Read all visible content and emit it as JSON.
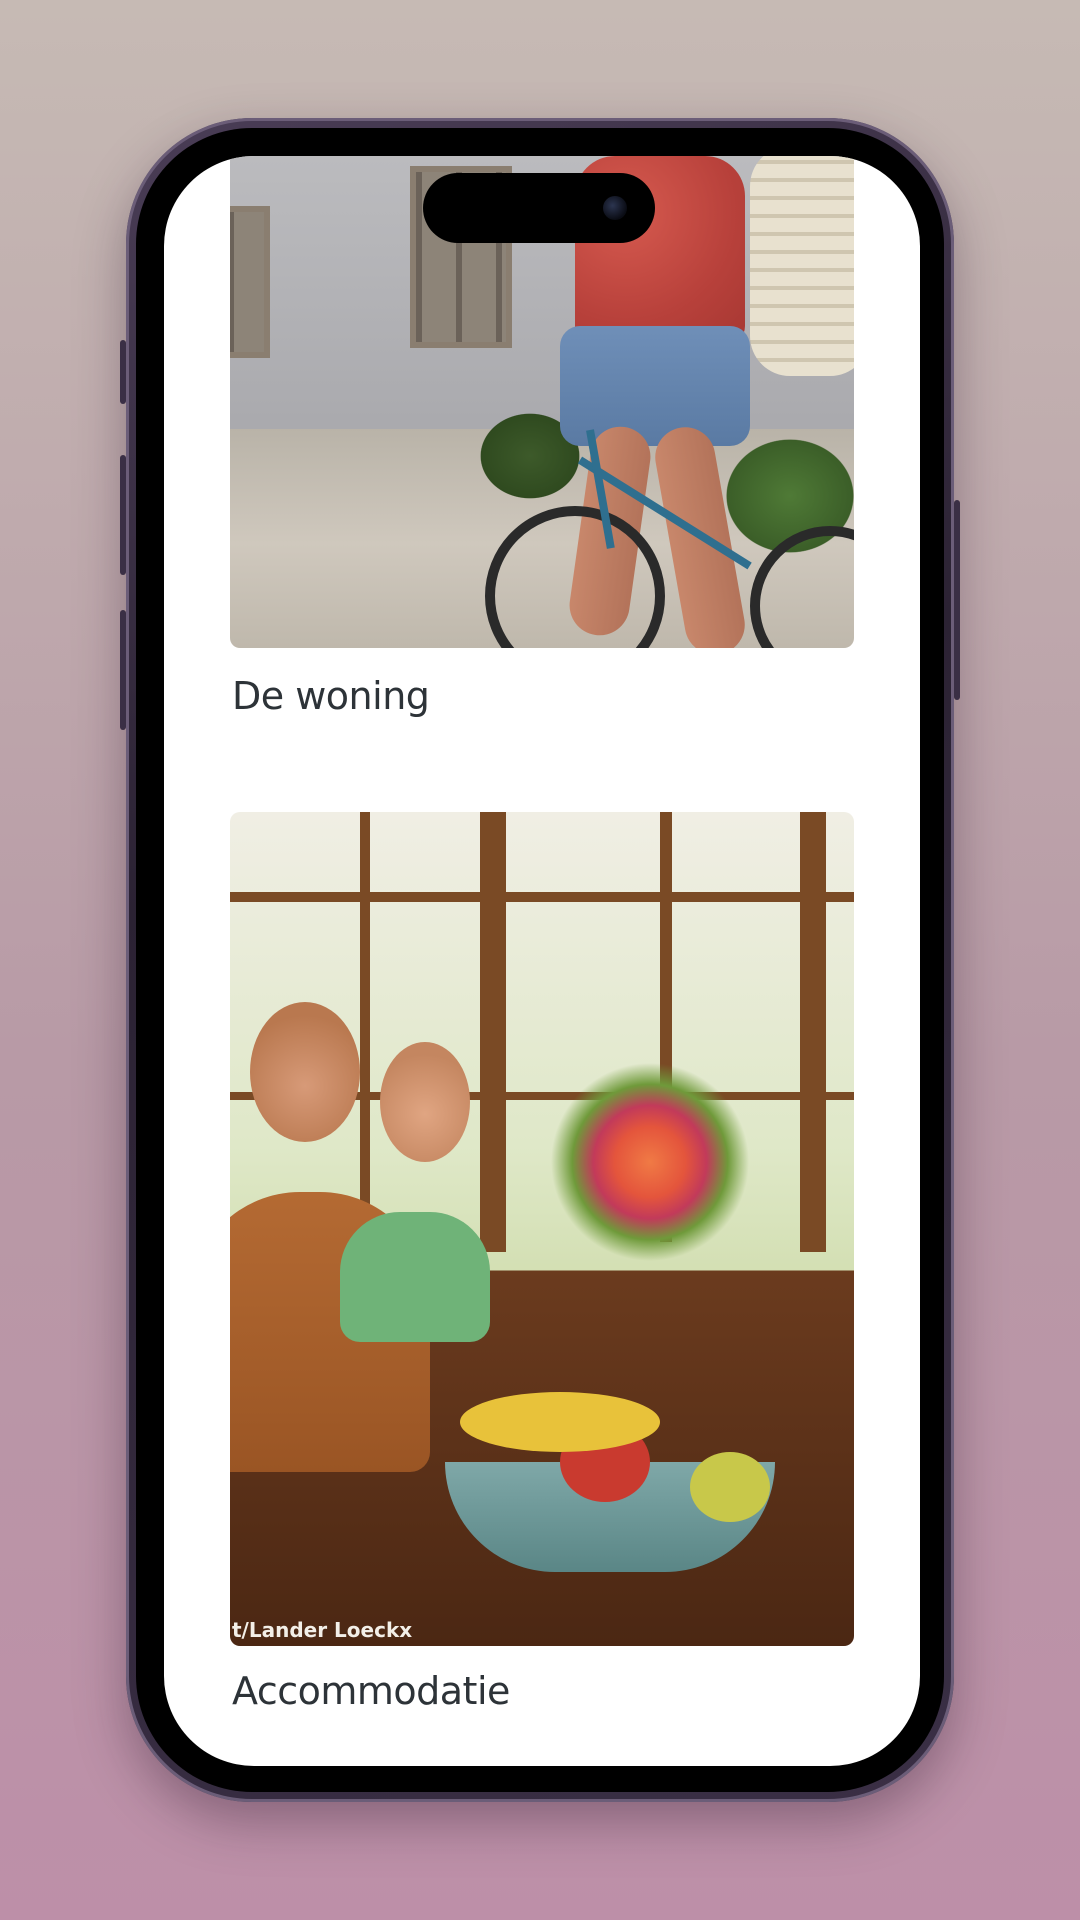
{
  "cards": [
    {
      "title": "De woning",
      "image_alt": "Two people riding bicycles past a grey house"
    },
    {
      "title": "Accommodatie",
      "image_alt": "Group of people sharing a breakfast at a long wooden table",
      "photo_credit": "t/Lander Loeckx"
    }
  ],
  "colors": {
    "title_text": "#2d3338",
    "background_top": "#c6bab4",
    "background_bottom": "#bd8fa8",
    "screen": "#ffffff"
  }
}
